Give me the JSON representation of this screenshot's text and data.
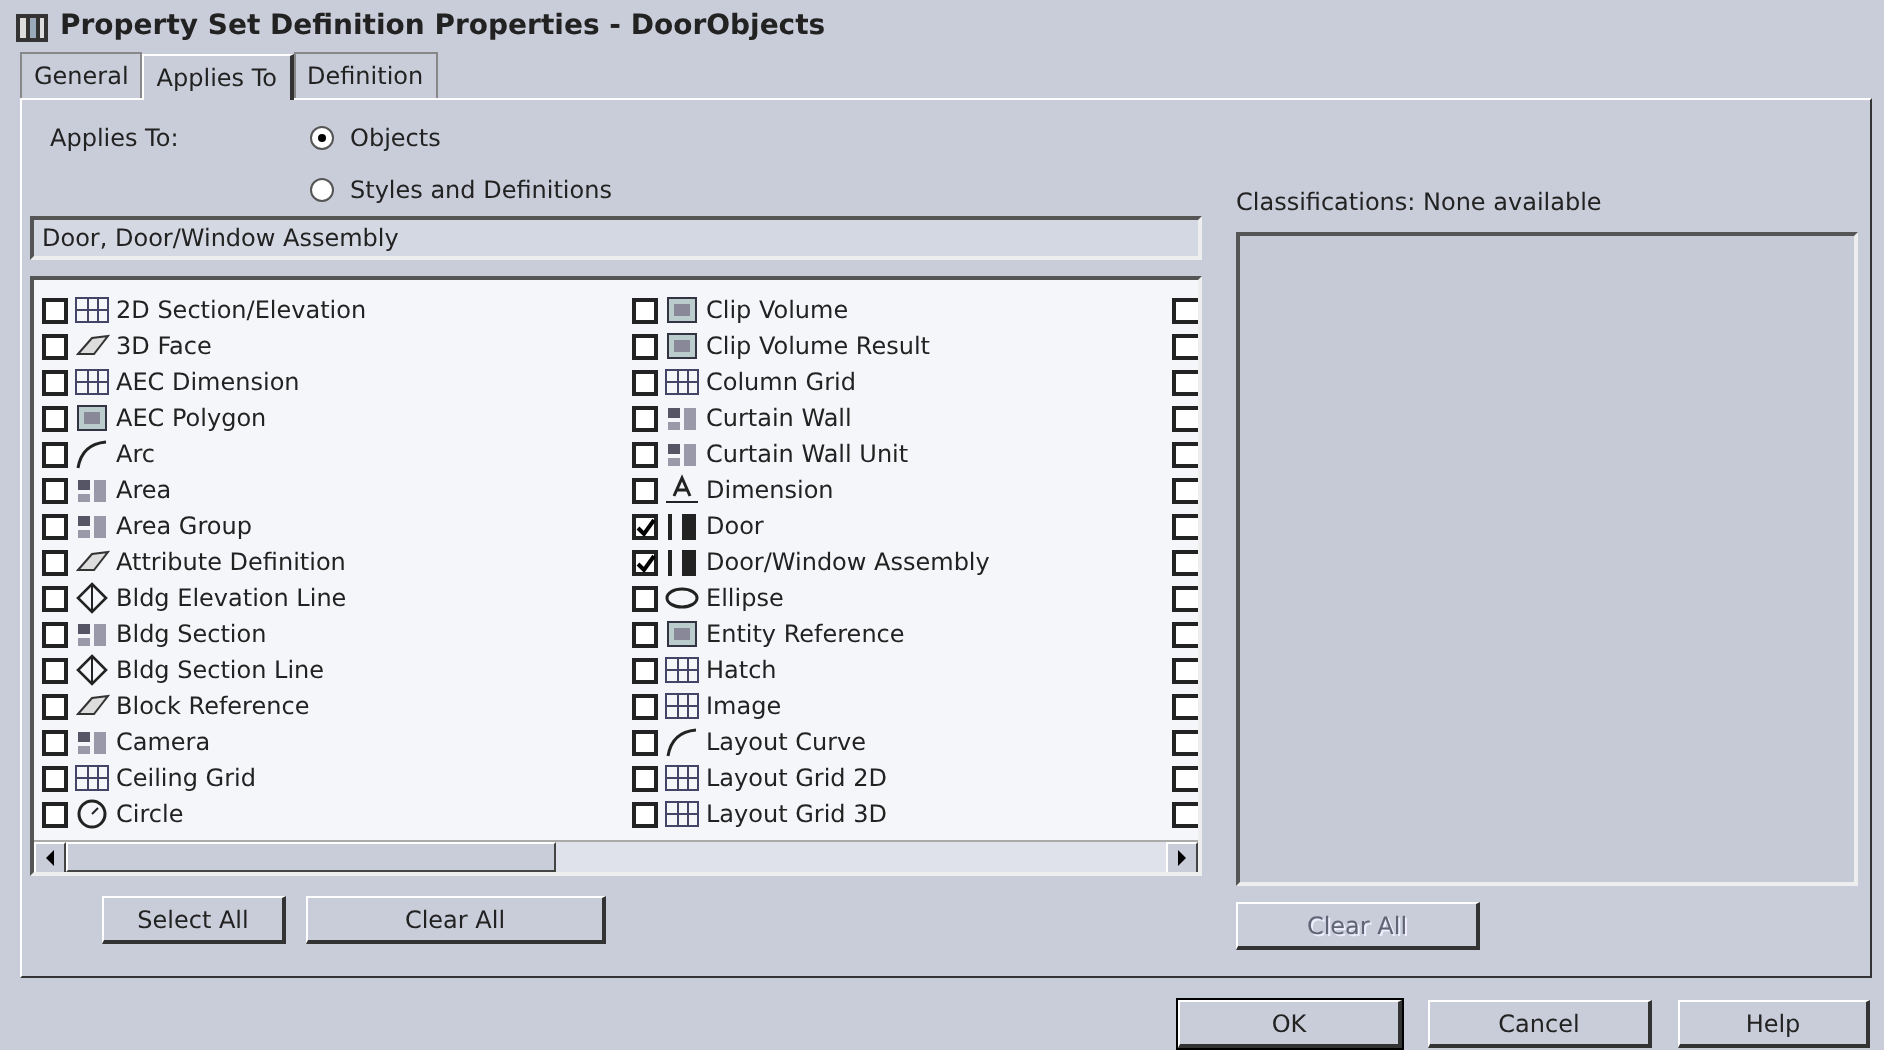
{
  "window": {
    "title": "Property Set Definition Properties - DoorObjects"
  },
  "tabs": [
    {
      "label": "General",
      "selected": false
    },
    {
      "label": "Applies To",
      "selected": true
    },
    {
      "label": "Definition",
      "selected": false
    }
  ],
  "applies_to": {
    "label": "Applies To:",
    "options": [
      {
        "label": "Objects",
        "selected": true
      },
      {
        "label": "Styles and Definitions",
        "selected": false
      }
    ]
  },
  "selection_field": {
    "value": "Door, Door/Window Assembly"
  },
  "object_list": {
    "columns": [
      [
        {
          "label": "2D Section/Elevation",
          "checked": false
        },
        {
          "label": "3D Face",
          "checked": false
        },
        {
          "label": "AEC Dimension",
          "checked": false
        },
        {
          "label": "AEC Polygon",
          "checked": false
        },
        {
          "label": "Arc",
          "checked": false
        },
        {
          "label": "Area",
          "checked": false
        },
        {
          "label": "Area Group",
          "checked": false
        },
        {
          "label": "Attribute Definition",
          "checked": false
        },
        {
          "label": "Bldg Elevation Line",
          "checked": false
        },
        {
          "label": "Bldg Section",
          "checked": false
        },
        {
          "label": "Bldg Section Line",
          "checked": false
        },
        {
          "label": "Block Reference",
          "checked": false
        },
        {
          "label": "Camera",
          "checked": false
        },
        {
          "label": "Ceiling Grid",
          "checked": false
        },
        {
          "label": "Circle",
          "checked": false
        }
      ],
      [
        {
          "label": "Clip Volume",
          "checked": false
        },
        {
          "label": "Clip Volume Result",
          "checked": false
        },
        {
          "label": "Column Grid",
          "checked": false
        },
        {
          "label": "Curtain Wall",
          "checked": false
        },
        {
          "label": "Curtain Wall Unit",
          "checked": false
        },
        {
          "label": "Dimension",
          "checked": false
        },
        {
          "label": "Door",
          "checked": true
        },
        {
          "label": "Door/Window Assembly",
          "checked": true
        },
        {
          "label": "Ellipse",
          "checked": false
        },
        {
          "label": "Entity Reference",
          "checked": false
        },
        {
          "label": "Hatch",
          "checked": false
        },
        {
          "label": "Image",
          "checked": false
        },
        {
          "label": "Layout Curve",
          "checked": false
        },
        {
          "label": "Layout Grid 2D",
          "checked": false
        },
        {
          "label": "Layout Grid 3D",
          "checked": false
        }
      ],
      [
        {
          "checked": false
        },
        {
          "checked": false
        },
        {
          "checked": false
        },
        {
          "checked": false
        },
        {
          "checked": false
        },
        {
          "checked": false
        },
        {
          "checked": false
        },
        {
          "checked": false
        },
        {
          "checked": false
        },
        {
          "checked": false
        },
        {
          "checked": false
        },
        {
          "checked": false
        },
        {
          "checked": false
        },
        {
          "checked": false
        },
        {
          "checked": false
        }
      ]
    ]
  },
  "left_buttons": [
    {
      "label": "Select All",
      "disabled": false
    },
    {
      "label": "Clear All",
      "disabled": false
    }
  ],
  "classifications": {
    "label": "Classifications: None available",
    "button": {
      "label": "Clear All",
      "disabled": true
    }
  },
  "dialog_buttons": [
    {
      "label": "OK",
      "default": true
    },
    {
      "label": "Cancel",
      "default": false
    },
    {
      "label": "Help",
      "default": false
    }
  ]
}
